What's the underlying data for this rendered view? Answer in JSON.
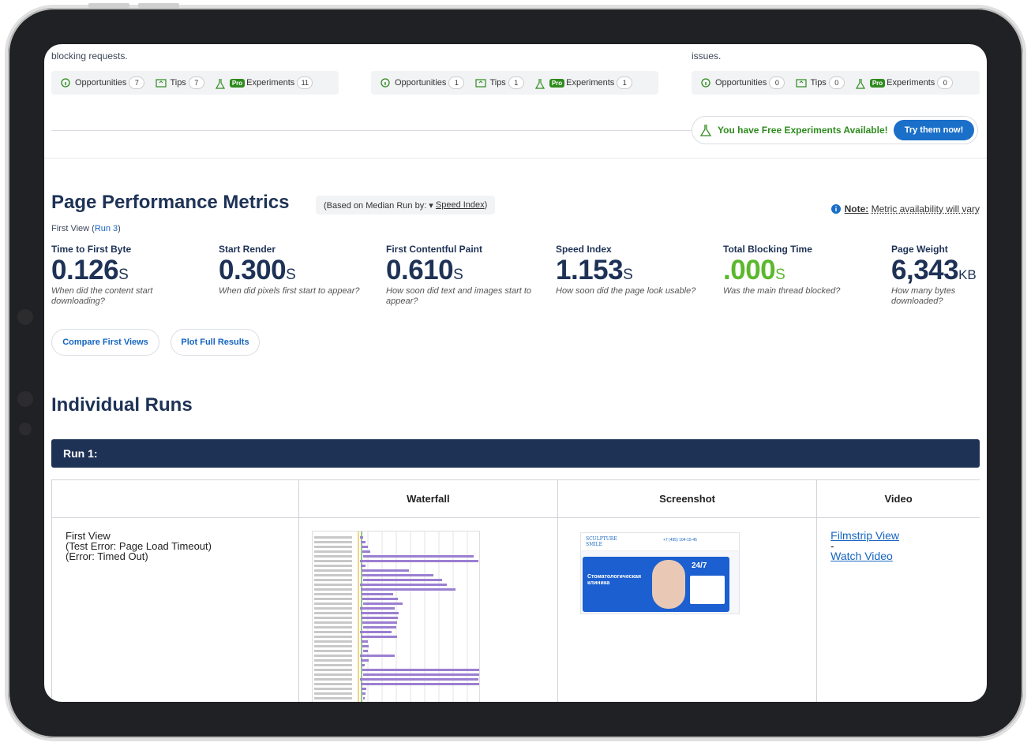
{
  "top_section": {
    "col1_tail": "blocking requests.",
    "col3_tail": "issues.",
    "groups": [
      {
        "opportunities_label": "Opportunities",
        "opportunities": "7",
        "tips_label": "Tips",
        "tips": "7",
        "pro": "Pro",
        "experiments_label": "Experiments",
        "experiments": "11"
      },
      {
        "opportunities_label": "Opportunities",
        "opportunities": "1",
        "tips_label": "Tips",
        "tips": "1",
        "pro": "Pro",
        "experiments_label": "Experiments",
        "experiments": "1"
      },
      {
        "opportunities_label": "Opportunities",
        "opportunities": "0",
        "tips_label": "Tips",
        "tips": "0",
        "pro": "Pro",
        "experiments_label": "Experiments",
        "experiments": "0"
      }
    ],
    "free_experiments_text": "You have Free Experiments Available!",
    "try_button": "Try them now!"
  },
  "metrics": {
    "title": "Page Performance Metrics",
    "median_prefix": "(Based on Median Run by: ▾",
    "median_link": "Speed Index",
    "median_suffix": ")",
    "note_label": "Note:",
    "note_text": "Metric availability will vary",
    "first_view_prefix": "First View (",
    "run_link": "Run 3",
    "first_view_suffix": ")",
    "items": [
      {
        "label": "Time to First Byte",
        "value": "0.126",
        "unit": "S",
        "desc": "When did the content start downloading?",
        "color": "#1e3256"
      },
      {
        "label": "Start Render",
        "value": "0.300",
        "unit": "S",
        "desc": "When did pixels first start to appear?",
        "color": "#1e3256"
      },
      {
        "label": "First Contentful Paint",
        "value": "0.610",
        "unit": "S",
        "desc": "How soon did text and images start to appear?",
        "color": "#1e3256"
      },
      {
        "label": "Speed Index",
        "value": "1.153",
        "unit": "S",
        "desc": "How soon did the page look usable?",
        "color": "#1e3256"
      },
      {
        "label": "Total Blocking Time",
        "value": ".000",
        "unit": "S",
        "desc": "Was the main thread blocked?",
        "color": "#5cb82d"
      },
      {
        "label": "Page Weight",
        "value": "6,343",
        "unit": "KB",
        "desc": "How many bytes downloaded?",
        "color": "#1e3256"
      }
    ],
    "compare_button": "Compare First Views",
    "plot_button": "Plot Full Results"
  },
  "runs": {
    "title": "Individual Runs",
    "run_header": "Run 1:",
    "columns": [
      "",
      "Waterfall",
      "Screenshot",
      "Video"
    ],
    "first_view_lines": [
      "First View",
      "(Test Error: Page Load Timeout)",
      "(Error: Timed Out)"
    ],
    "filmstrip_link": "Filmstrip View",
    "dash": "-",
    "watch_link": "Watch Video",
    "screenshot_text": {
      "brand": "SCULPTURE SMILE",
      "phone": "+7 (495) 104-15-45",
      "title": "Стоматологическая клиника",
      "hours": "24/7"
    }
  },
  "colors": {
    "navy": "#1e3256",
    "link": "#1565c0",
    "green": "#5cb82d",
    "pro_green": "#2f8b1e",
    "try_button_bg": "#1a6fc9"
  }
}
